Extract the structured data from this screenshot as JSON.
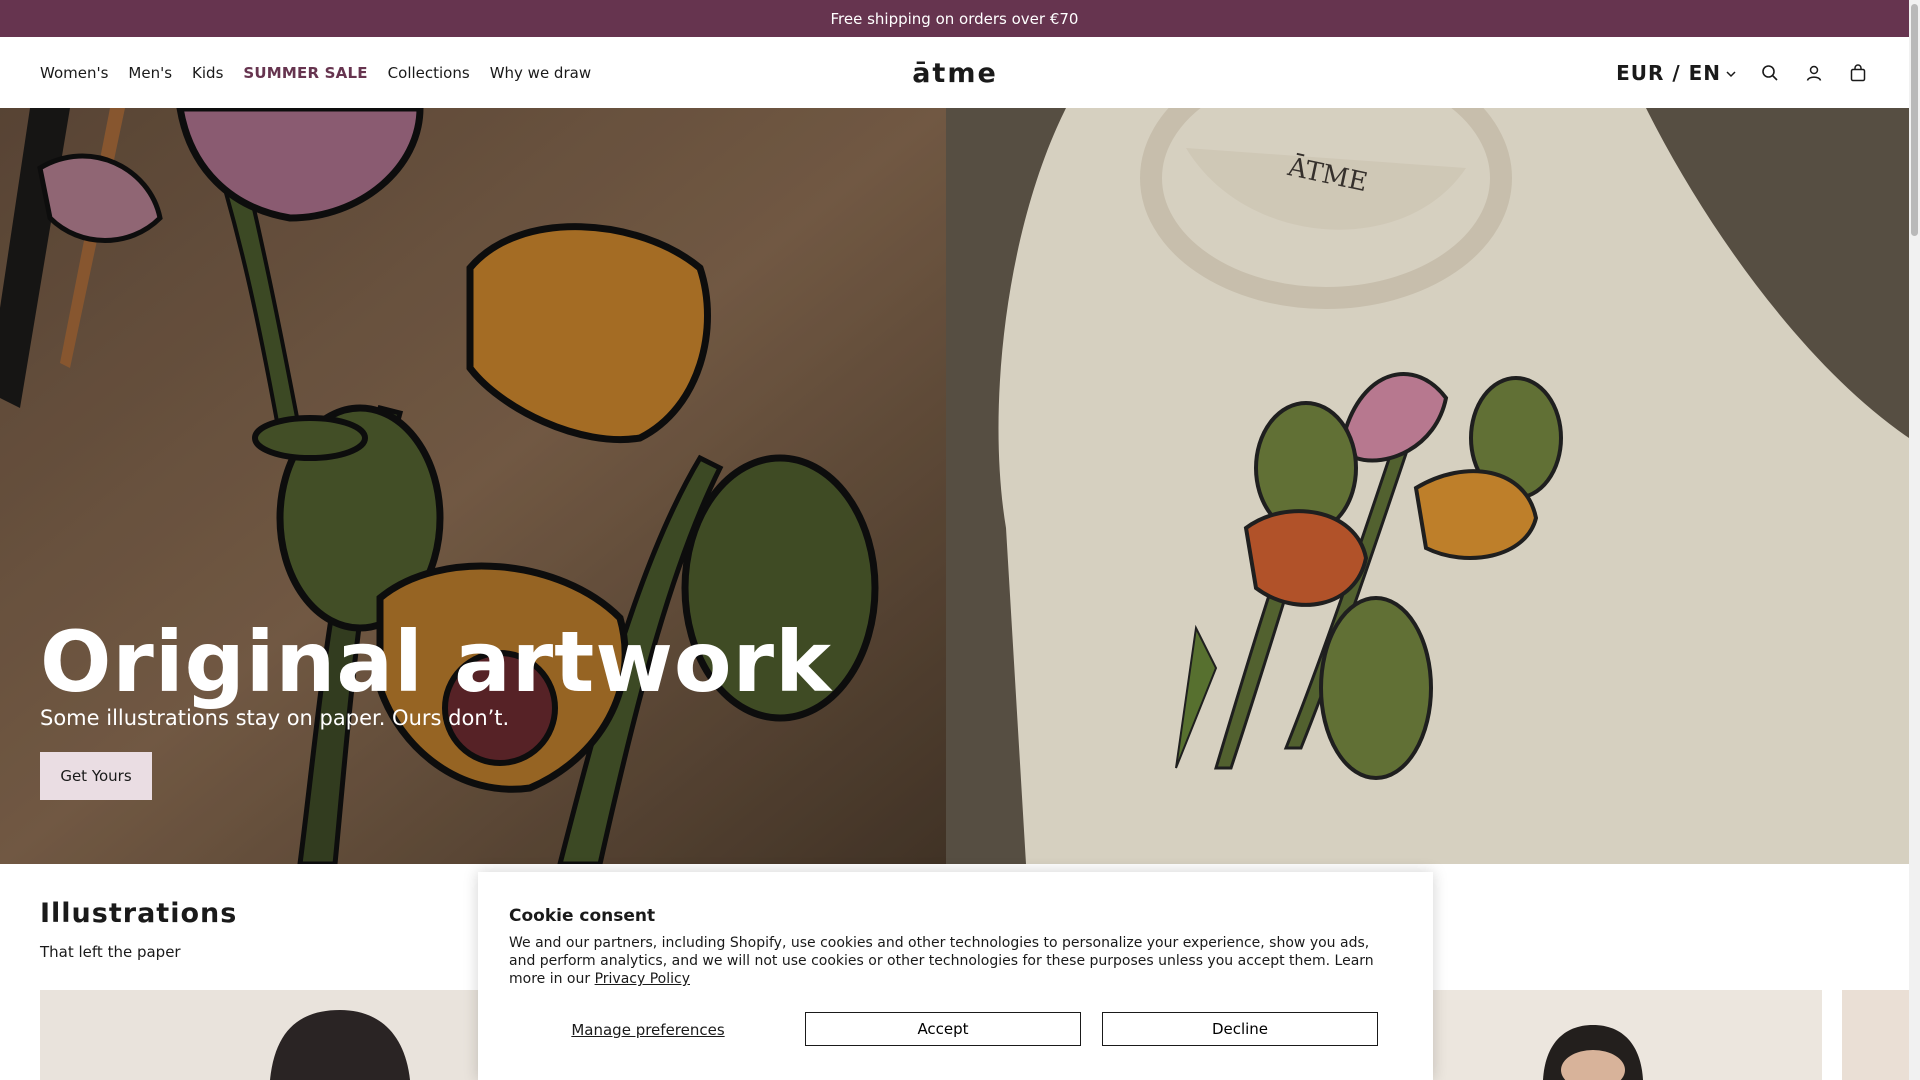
{
  "announcement": {
    "text": "Free shipping on orders over €70"
  },
  "header": {
    "nav": [
      {
        "label": "Women's"
      },
      {
        "label": "Men's"
      },
      {
        "label": "Kids"
      },
      {
        "label": "SUMMER SALE"
      },
      {
        "label": "Collections"
      },
      {
        "label": "Why we draw"
      }
    ],
    "logo": "ātme",
    "locale": "EUR / EN",
    "icons": [
      "search-icon",
      "account-icon",
      "cart-icon"
    ]
  },
  "hero": {
    "title": "Original artwork",
    "subtitle": "Some illustrations stay on paper. Ours don’t.",
    "cta": "Get Yours"
  },
  "illustrations": {
    "title": "Illustrations",
    "subtitle": "That left the paper"
  },
  "cookie": {
    "title": "Cookie consent",
    "body": "We and our partners, including Shopify, use cookies and other technologies to personalize your experience, show you ads, and perform analytics, and we will not use cookies or other technologies for these purposes unless you accept them. Learn more in our ",
    "link": "Privacy Policy",
    "manage": "Manage preferences",
    "accept": "Accept",
    "decline": "Decline"
  },
  "colors": {
    "brand": "#66344f",
    "cta_bg": "#eadde3"
  }
}
